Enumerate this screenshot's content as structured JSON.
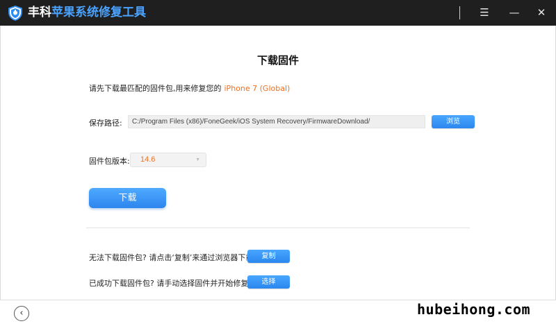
{
  "titlebar": {
    "brand": "丰科",
    "product": "苹果系统修复工具",
    "menu_glyph": "☰",
    "minimize_glyph": "—",
    "close_glyph": "✕"
  },
  "main": {
    "title": "下载固件",
    "intro_text": "请先下载最匹配的固件包,用来修复您的",
    "device": "iPhone 7 (Global)",
    "save_path_label": "保存路径:",
    "save_path_value": "C:/Program Files (x86)/FoneGeek/iOS System Recovery/FirmwareDownload/",
    "browse_label": "浏览",
    "version_label": "固件包版本:",
    "version_value": "14.6",
    "download_label": "下载"
  },
  "help": {
    "copy_prompt": "无法下载固件包? 请点击‘复制’来通过浏览器下载",
    "copy_button": "复制",
    "select_prompt": "已成功下载固件包? 请手动选择固件并开始修复",
    "select_button": "选择"
  },
  "footer": {
    "back_glyph": "‹",
    "watermark": "hubeihong.com"
  },
  "colors": {
    "titlebar_bg": "#1f1f1f",
    "accent_blue": "#2f8cf0",
    "highlight_orange": "#f07020"
  },
  "icons": [
    "shield-wrench-logo-icon",
    "menu-icon",
    "minimize-icon",
    "close-icon",
    "chevron-left-icon",
    "dropdown-arrow-icon"
  ]
}
